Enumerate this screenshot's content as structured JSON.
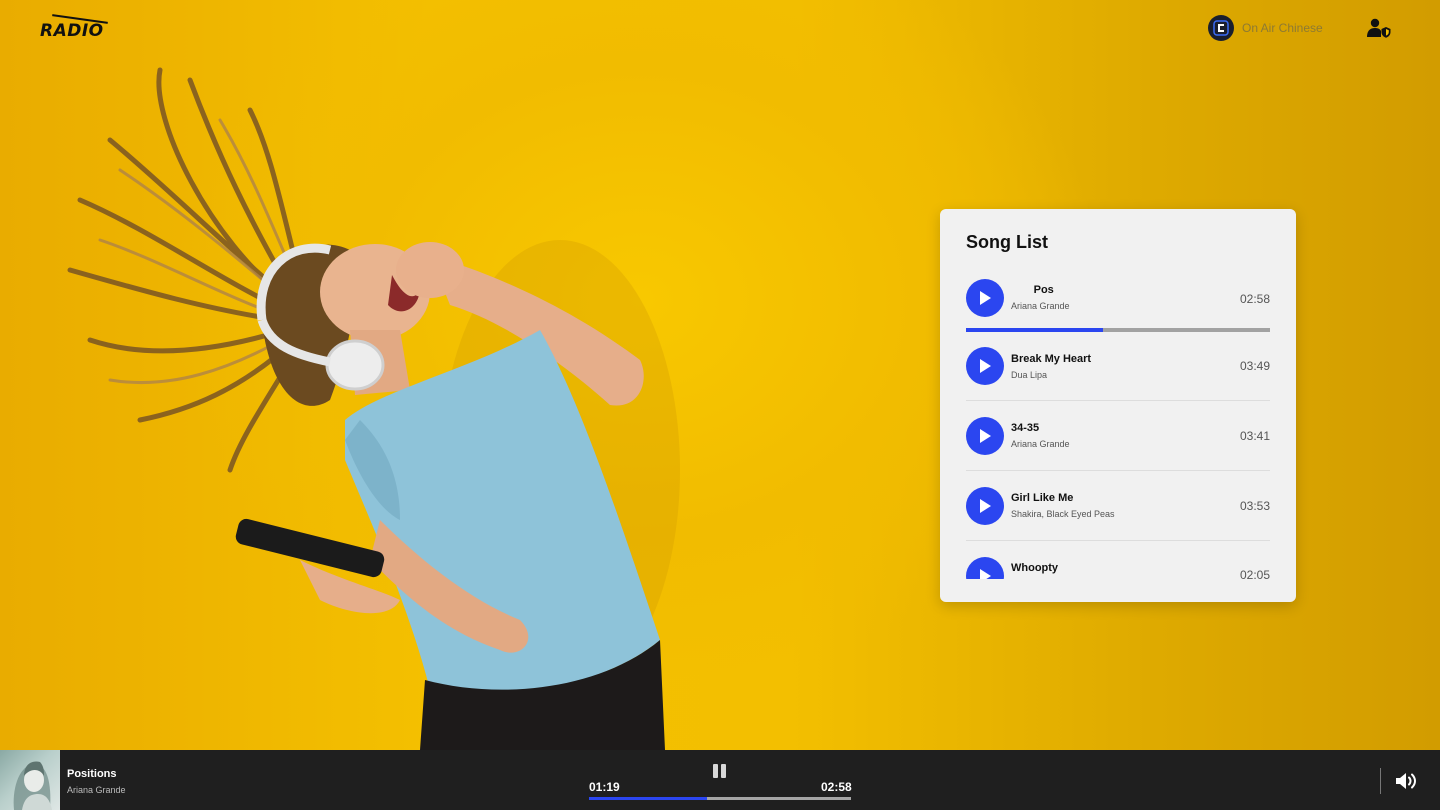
{
  "header": {
    "logo_text": "RADIO",
    "station_label": "On Air Chinese",
    "icons": {
      "station": "station-logo-icon",
      "account": "user-shield-icon"
    }
  },
  "song_list": {
    "title": "Song List",
    "now_playing": {
      "title_marquee": "ons Pos",
      "artist": "Ariana Grande",
      "duration": "02:58",
      "progress_fraction": 0.45
    },
    "songs": [
      {
        "title": "Break My Heart",
        "artist": "Dua Lipa",
        "duration": "03:49"
      },
      {
        "title": "34-35",
        "artist": "Ariana Grande",
        "duration": "03:41"
      },
      {
        "title": "Girl Like Me",
        "artist": "Shakira, Black Eyed Peas",
        "duration": "03:53"
      },
      {
        "title": "Whoopty",
        "artist": "",
        "duration": "02:05"
      }
    ]
  },
  "player": {
    "title": "Positions",
    "artist": "Ariana Grande",
    "current_time": "01:19",
    "total_time": "02:58",
    "progress_fraction": 0.45,
    "icons": {
      "play_state": "pause-icon",
      "volume": "volume-up-icon"
    }
  },
  "colors": {
    "accent": "#2b46f0",
    "background": "#f2b800",
    "player_bar": "#1f1f1f",
    "card": "#f1f1f1"
  }
}
